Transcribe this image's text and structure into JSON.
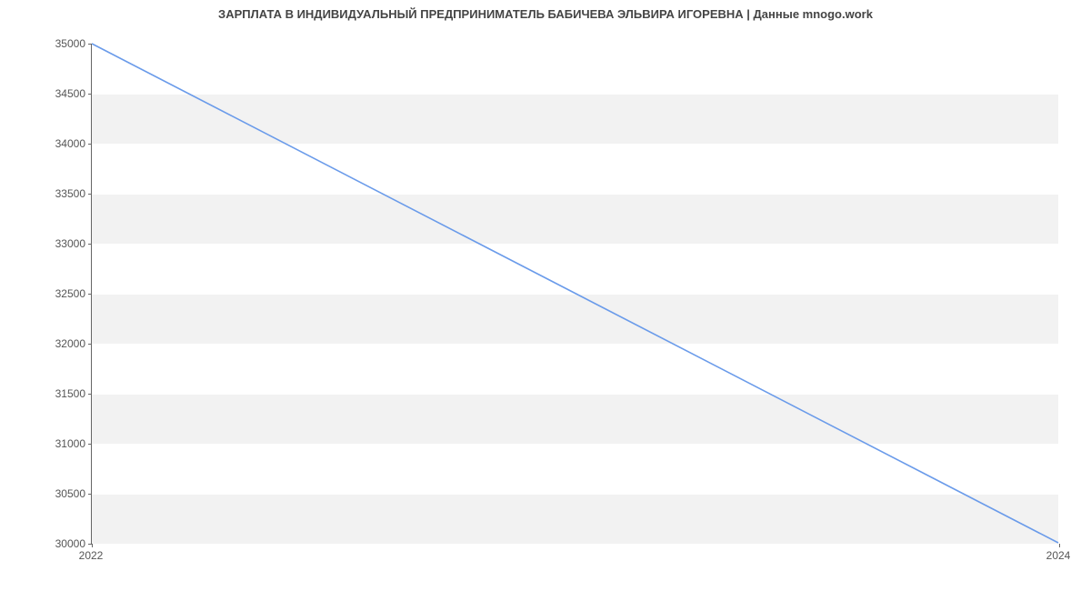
{
  "chart_data": {
    "type": "line",
    "title": "ЗАРПЛАТА В ИНДИВИДУАЛЬНЫЙ ПРЕДПРИНИМАТЕЛЬ БАБИЧЕВА ЭЛЬВИРА ИГОРЕВНА | Данные mnogo.work",
    "x": [
      2022,
      2024
    ],
    "values": [
      35000,
      30000
    ],
    "xlabel": "",
    "ylabel": "",
    "ylim": [
      30000,
      35000
    ],
    "xlim": [
      2022,
      2024
    ],
    "xticks": [
      2022,
      2024
    ],
    "yticks": [
      30000,
      30500,
      31000,
      31500,
      32000,
      32500,
      33000,
      33500,
      34000,
      34500,
      35000
    ],
    "line_color": "#6a9bea"
  }
}
